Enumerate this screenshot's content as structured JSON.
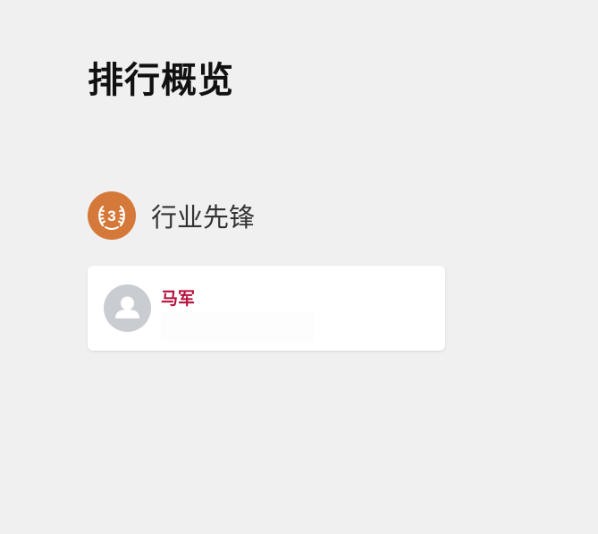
{
  "page": {
    "title": "排行概览"
  },
  "section": {
    "medal_icon": "bronze-medal-3-icon",
    "medal_number": "3",
    "medal_color": "#d4793a",
    "title": "行业先锋"
  },
  "leaderboard": {
    "items": [
      {
        "avatar_icon": "default-avatar-icon",
        "name": "马军",
        "name_color": "#b5123e",
        "subtitle": ""
      }
    ]
  }
}
